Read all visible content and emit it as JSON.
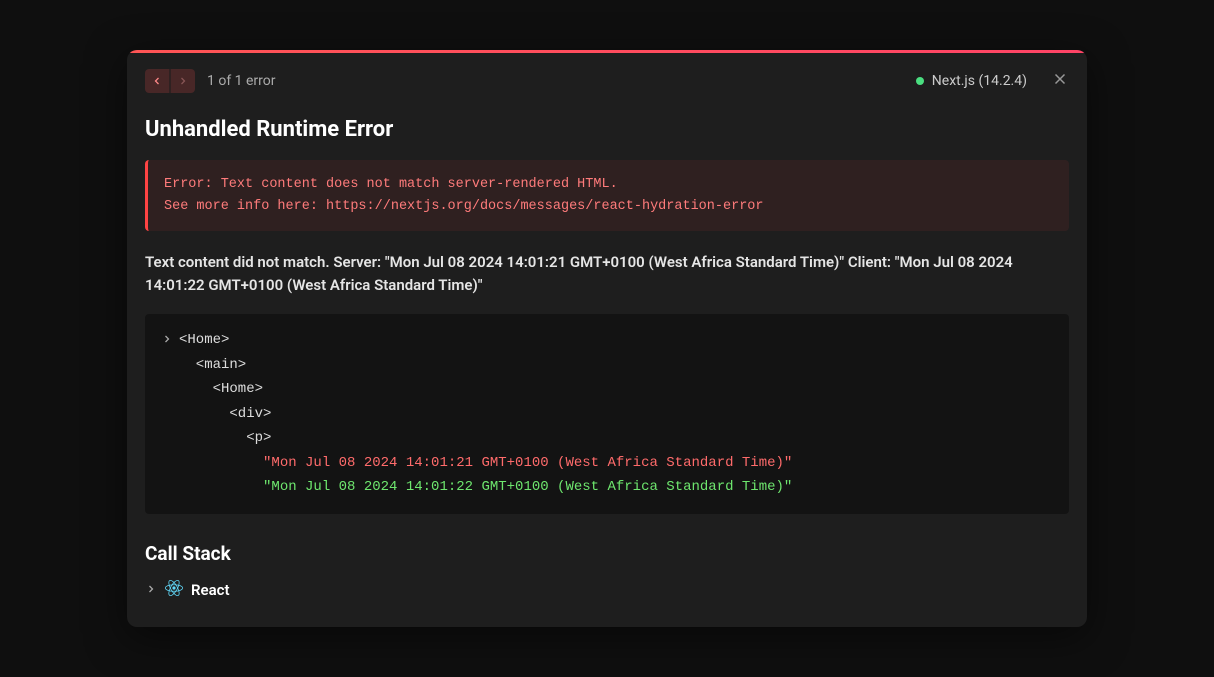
{
  "header": {
    "error_count": "1 of 1 error",
    "framework": "Next.js (14.2.4)"
  },
  "title": "Unhandled Runtime Error",
  "error_block": {
    "line1": "Error: Text content does not match server-rendered HTML.",
    "line2": "See more info here: https://nextjs.org/docs/messages/react-hydration-error"
  },
  "mismatch": "Text content did not match. Server: \"Mon Jul 08 2024 14:01:21 GMT+0100 (West Africa Standard Time)\" Client: \"Mon Jul 08 2024 14:01:22 GMT+0100 (West Africa Standard Time)\"",
  "code": {
    "l1": "<Home>",
    "l2": "  <main>",
    "l3": "    <Home>",
    "l4": "      <div>",
    "l5": "        <p>",
    "l6": "          \"Mon Jul 08 2024 14:01:21 GMT+0100 (West Africa Standard Time)\"",
    "l7": "          \"Mon Jul 08 2024 14:01:22 GMT+0100 (West Africa Standard Time)\""
  },
  "callstack": {
    "title": "Call Stack",
    "item": "React"
  }
}
